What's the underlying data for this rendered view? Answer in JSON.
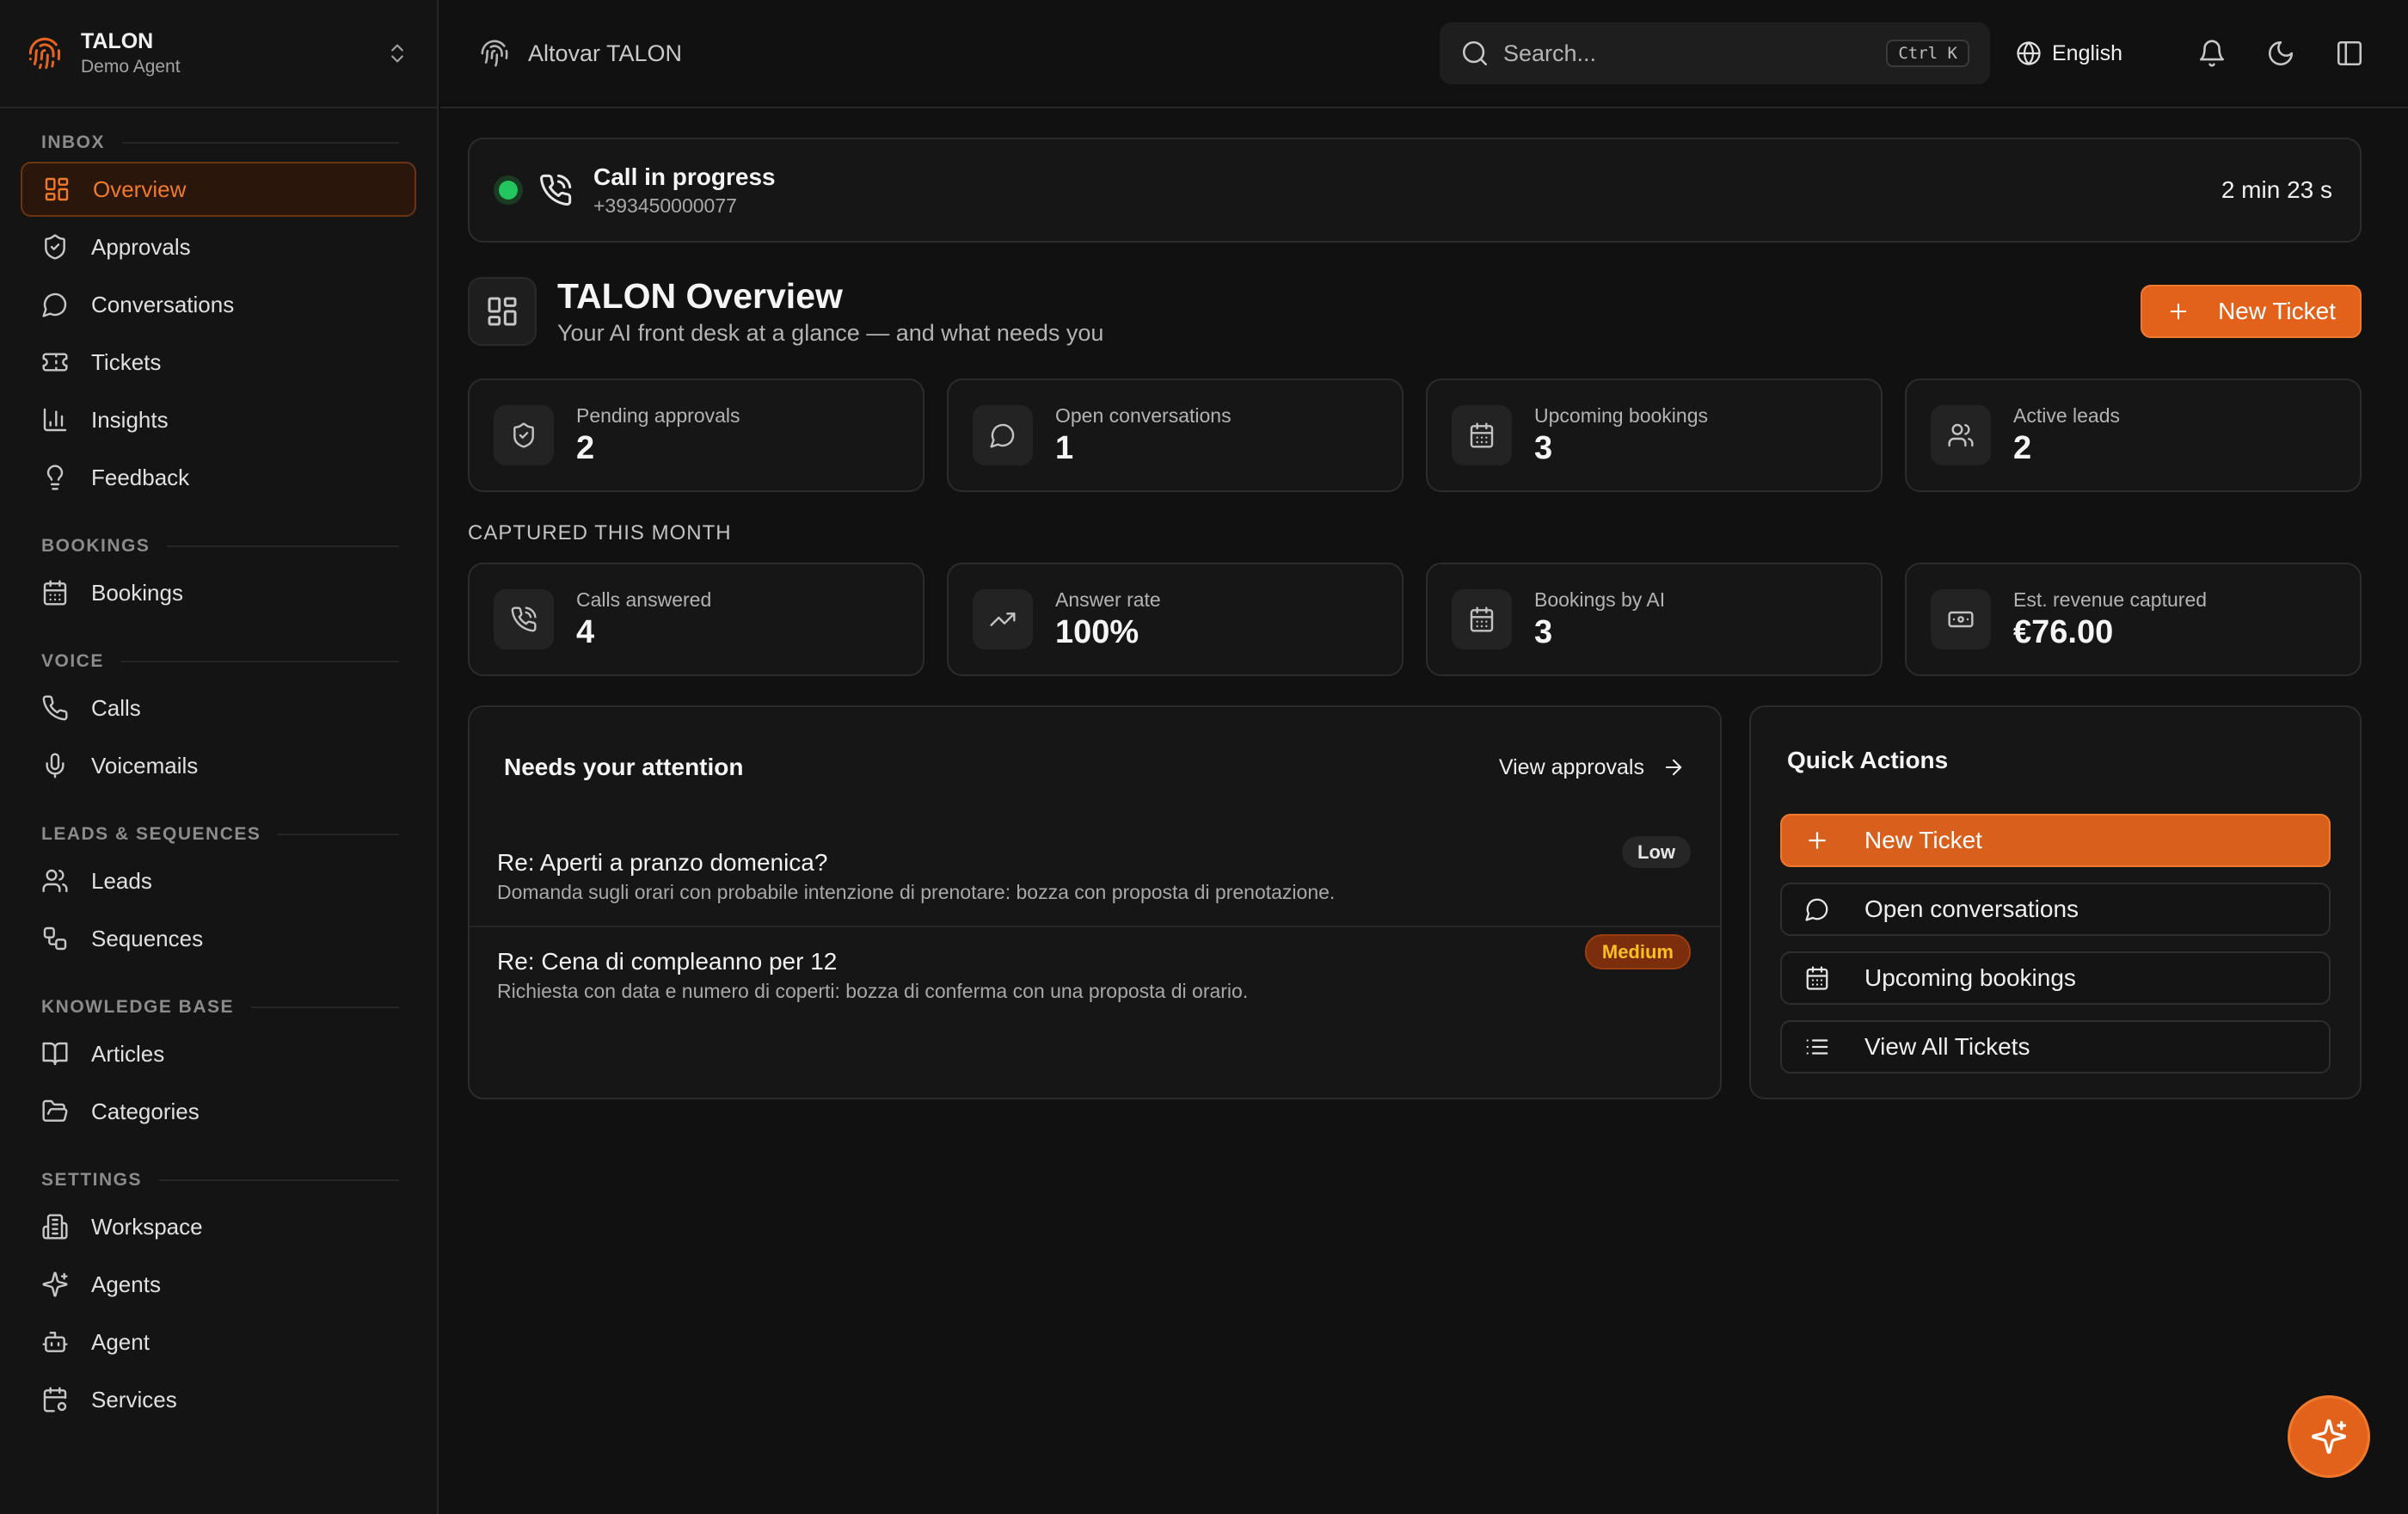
{
  "brand": {
    "name": "TALON",
    "subtitle": "Demo Agent"
  },
  "sidebar": {
    "sections": [
      {
        "label": "INBOX",
        "items": [
          {
            "label": "Overview",
            "icon": "grid-icon",
            "active": true
          },
          {
            "label": "Approvals",
            "icon": "shield-check-icon"
          },
          {
            "label": "Conversations",
            "icon": "chat-bubble-icon"
          },
          {
            "label": "Tickets",
            "icon": "ticket-icon"
          },
          {
            "label": "Insights",
            "icon": "bar-chart-icon"
          },
          {
            "label": "Feedback",
            "icon": "lightbulb-icon"
          }
        ]
      },
      {
        "label": "BOOKINGS",
        "items": [
          {
            "label": "Bookings",
            "icon": "calendar-icon"
          }
        ]
      },
      {
        "label": "VOICE",
        "items": [
          {
            "label": "Calls",
            "icon": "phone-icon"
          },
          {
            "label": "Voicemails",
            "icon": "microphone-icon"
          }
        ]
      },
      {
        "label": "LEADS & SEQUENCES",
        "items": [
          {
            "label": "Leads",
            "icon": "users-icon"
          },
          {
            "label": "Sequences",
            "icon": "workflow-icon"
          }
        ]
      },
      {
        "label": "KNOWLEDGE BASE",
        "items": [
          {
            "label": "Articles",
            "icon": "book-open-icon"
          },
          {
            "label": "Categories",
            "icon": "folder-open-icon"
          }
        ]
      },
      {
        "label": "SETTINGS",
        "items": [
          {
            "label": "Workspace",
            "icon": "building-icon"
          },
          {
            "label": "Agents",
            "icon": "sparkles-icon"
          },
          {
            "label": "Agent",
            "icon": "bot-icon"
          },
          {
            "label": "Services",
            "icon": "calendar-cog-icon"
          }
        ]
      }
    ]
  },
  "topbar": {
    "breadcrumb": "Altovar TALON",
    "search_placeholder": "Search...",
    "search_shortcut": "Ctrl K",
    "language": "English"
  },
  "call": {
    "title": "Call in progress",
    "number": "+393450000077",
    "duration": "2 min 23 s",
    "status_color": "#22c55e"
  },
  "page": {
    "title": "TALON Overview",
    "subtitle": "Your AI front desk at a glance — and what needs you",
    "new_ticket_label": "New Ticket"
  },
  "stats_primary": [
    {
      "label": "Pending approvals",
      "value": "2",
      "icon": "shield-check-icon"
    },
    {
      "label": "Open conversations",
      "value": "1",
      "icon": "chat-bubble-icon"
    },
    {
      "label": "Upcoming bookings",
      "value": "3",
      "icon": "calendar-icon"
    },
    {
      "label": "Active leads",
      "value": "2",
      "icon": "users-icon"
    }
  ],
  "captured_label": "CAPTURED THIS MONTH",
  "stats_captured": [
    {
      "label": "Calls answered",
      "value": "4",
      "icon": "phone-incoming-icon"
    },
    {
      "label": "Answer rate",
      "value": "100%",
      "icon": "trending-up-icon"
    },
    {
      "label": "Bookings by AI",
      "value": "3",
      "icon": "calendar-icon"
    },
    {
      "label": "Est. revenue captured",
      "value": "€76.00",
      "icon": "banknote-icon"
    }
  ],
  "attention": {
    "title": "Needs your attention",
    "link_label": "View approvals",
    "items": [
      {
        "title": "Re: Aperti a pranzo domenica?",
        "description": "Domanda sugli orari con probabile intenzione di prenotare: bozza con proposta di prenotazione.",
        "priority": "Low"
      },
      {
        "title": "Re: Cena di compleanno per 12",
        "description": "Richiesta con data e numero di coperti: bozza di conferma con una proposta di orario.",
        "priority": "Medium"
      }
    ]
  },
  "quick_actions": {
    "title": "Quick Actions",
    "items": [
      {
        "label": "New Ticket",
        "icon": "plus-icon"
      },
      {
        "label": "Open conversations",
        "icon": "chat-bubble-icon"
      },
      {
        "label": "Upcoming bookings",
        "icon": "calendar-icon"
      },
      {
        "label": "View All Tickets",
        "icon": "list-icon"
      }
    ]
  },
  "colors": {
    "accent": "#e2621c",
    "background": "#111111",
    "surface": "#161616"
  }
}
